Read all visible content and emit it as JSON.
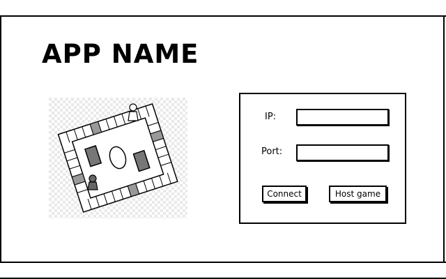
{
  "app": {
    "title": "APP NAME"
  },
  "board": {
    "icon": "board-game-image"
  },
  "form": {
    "ip_label": "IP:",
    "ip_value": "",
    "port_label": "Port:",
    "port_value": "",
    "connect_label": "Connect",
    "host_label": "Host game"
  }
}
